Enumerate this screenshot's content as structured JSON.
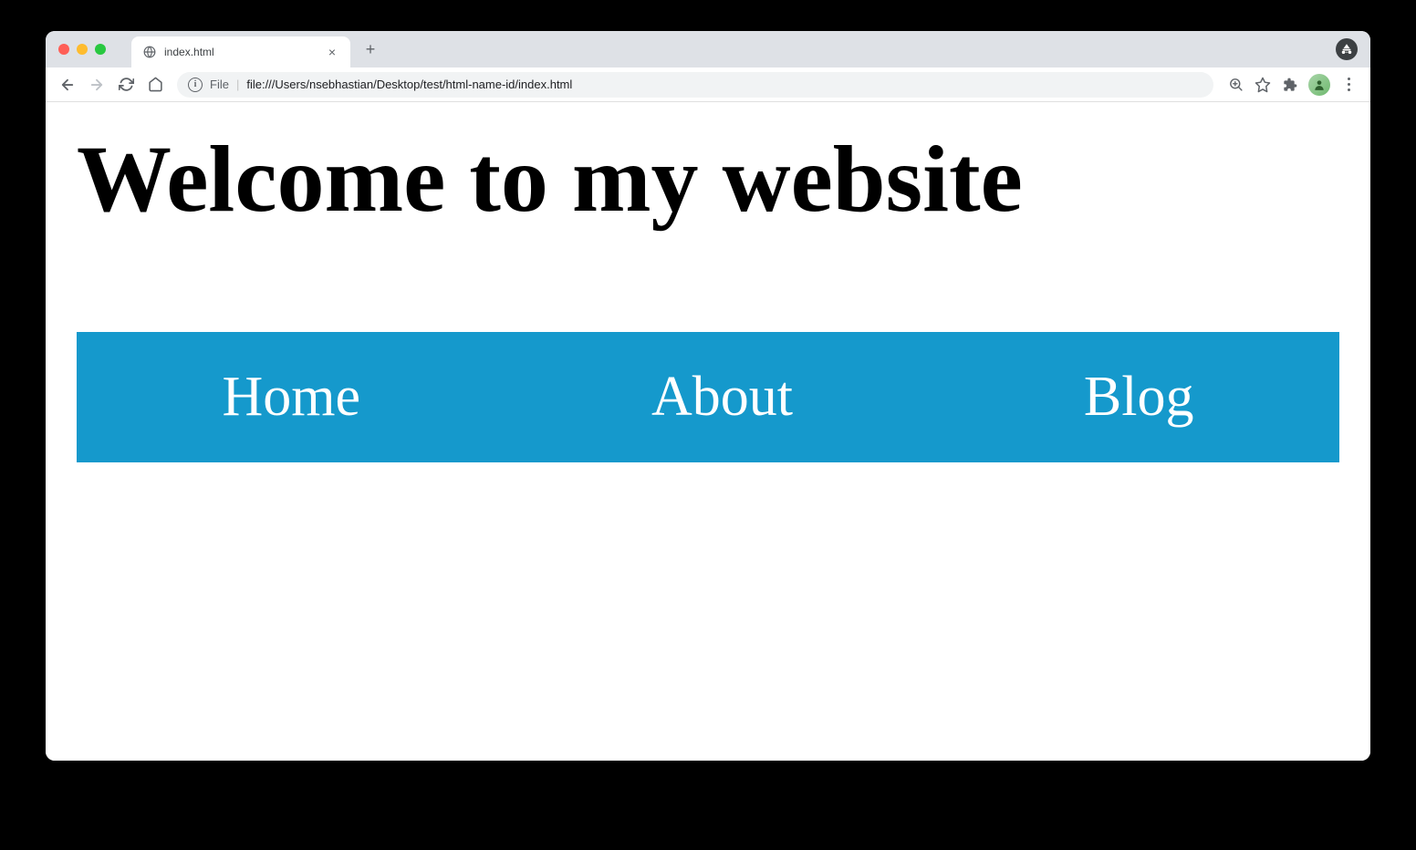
{
  "browser": {
    "tab_title": "index.html",
    "address_scheme": "File",
    "address_path": "file:///Users/nsebhastian/Desktop/test/html-name-id/index.html"
  },
  "page": {
    "heading": "Welcome to my website",
    "nav": [
      {
        "label": "Home"
      },
      {
        "label": "About"
      },
      {
        "label": "Blog"
      }
    ]
  },
  "colors": {
    "nav_background": "#1599cc"
  }
}
